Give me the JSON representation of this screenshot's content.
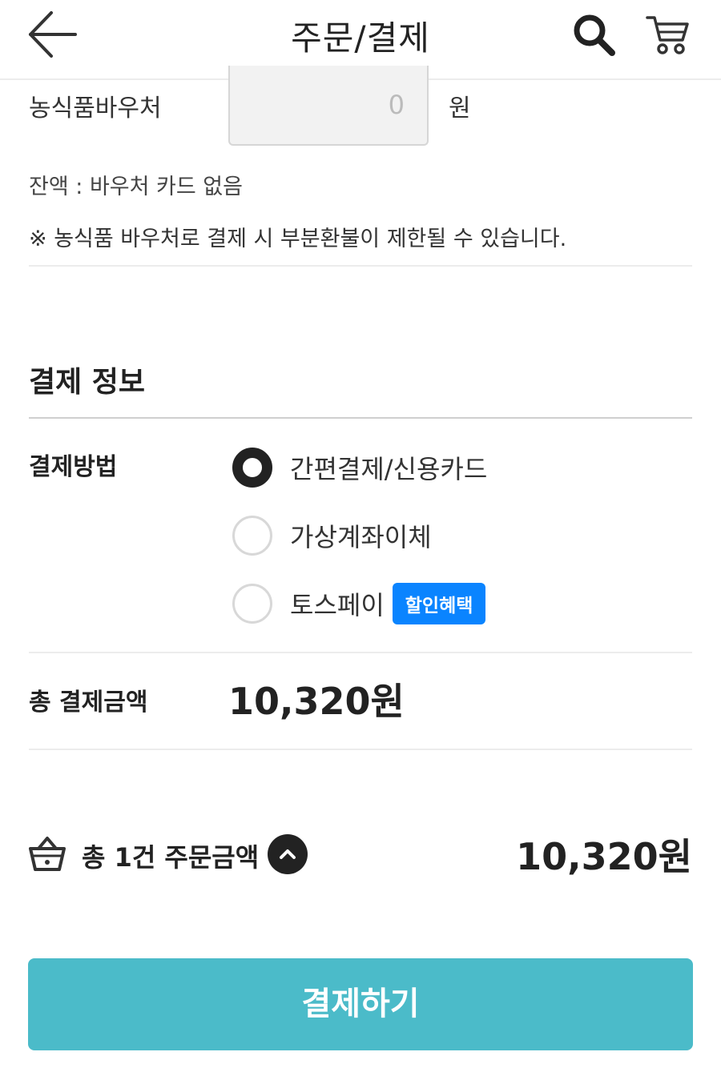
{
  "header": {
    "title": "주문/결제",
    "back_icon": "arrow-left-icon",
    "search_icon": "search-icon",
    "cart_icon": "cart-icon"
  },
  "voucher": {
    "label": "농식품바우처",
    "value": "0",
    "unit": "원",
    "balance_text": "잔액 : 바우처 카드 없음",
    "notice": "※ 농식품 바우처로 결제 시 부분환불이 제한될 수 있습니다."
  },
  "payment_info": {
    "section_title": "결제 정보",
    "method_label": "결제방법",
    "methods": [
      {
        "label": "간편결제/신용카드",
        "selected": true
      },
      {
        "label": "가상계좌이체",
        "selected": false
      },
      {
        "label": "토스페이",
        "selected": false,
        "badge": "할인혜택"
      }
    ],
    "total_label": "총 결제금액",
    "total_value": "10,320원"
  },
  "order_summary": {
    "text": "총 1건 주문금액",
    "amount": "10,320원",
    "basket_icon": "basket-icon",
    "toggle_icon": "chevron-up-icon"
  },
  "pay_button": {
    "label": "결제하기"
  },
  "colors": {
    "accent": "#4bbbc9",
    "badge": "#0a84ff",
    "text": "#222222"
  }
}
